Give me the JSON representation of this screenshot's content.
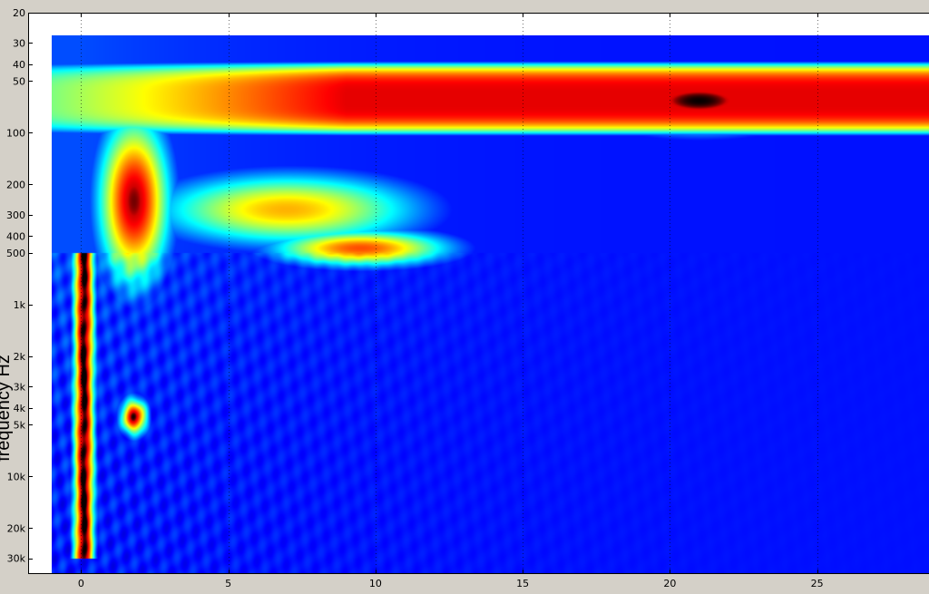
{
  "chart_data": {
    "type": "heatmap",
    "title": "",
    "xlabel": "",
    "ylabel": "frequency Hz",
    "x_scale": "linear",
    "y_scale": "log",
    "xlim": [
      -1.8,
      28.8
    ],
    "ylim": [
      20,
      37000
    ],
    "y_reversed": true,
    "grid": true,
    "colormap": "jet",
    "x_ticks": [
      0,
      5,
      10,
      15,
      20,
      25
    ],
    "x_tick_labels": [
      "0",
      "5",
      "10",
      "15",
      "20",
      "25"
    ],
    "y_ticks": [
      20,
      30,
      40,
      50,
      100,
      200,
      300,
      400,
      500,
      1000,
      2000,
      3000,
      4000,
      5000,
      10000,
      20000,
      30000
    ],
    "y_tick_labels": [
      "20",
      "30",
      "40",
      "50",
      "100",
      "200",
      "300",
      "400",
      "500",
      "1k",
      "2k",
      "3k",
      "4k",
      "5k",
      "10k",
      "20k",
      "30k"
    ],
    "data_extent": {
      "x": [
        -1,
        28.8
      ],
      "y_hz": [
        27,
        37000
      ]
    },
    "features": [
      {
        "type": "band",
        "f_low_hz": 40,
        "f_high_hz": 100,
        "x_start": -1,
        "x_end": 28.8,
        "level": 0.9,
        "level_start": 0.5
      },
      {
        "type": "blob",
        "x_center": 21,
        "f_center_hz": 65,
        "x_width": 3.2,
        "f_width_oct": 0.55,
        "level": 1.0
      },
      {
        "type": "blob",
        "x_center": 1.8,
        "f_center_hz": 250,
        "x_width": 1.2,
        "f_width_oct": 1.6,
        "level": 0.95
      },
      {
        "type": "blob",
        "x_center": 7,
        "f_center_hz": 280,
        "x_width": 4.5,
        "f_width_oct": 0.7,
        "level": 0.7
      },
      {
        "type": "blob",
        "x_center": 9.5,
        "f_center_hz": 470,
        "x_width": 3.0,
        "f_width_oct": 0.35,
        "level": 0.8
      },
      {
        "type": "ridge",
        "x": 0.1,
        "f_low_hz": 500,
        "f_high_hz": 30000,
        "level": 1.0
      },
      {
        "type": "blob",
        "x_center": 1.8,
        "f_center_hz": 4500,
        "x_width": 0.45,
        "f_width_oct": 0.35,
        "level": 0.95
      }
    ]
  }
}
